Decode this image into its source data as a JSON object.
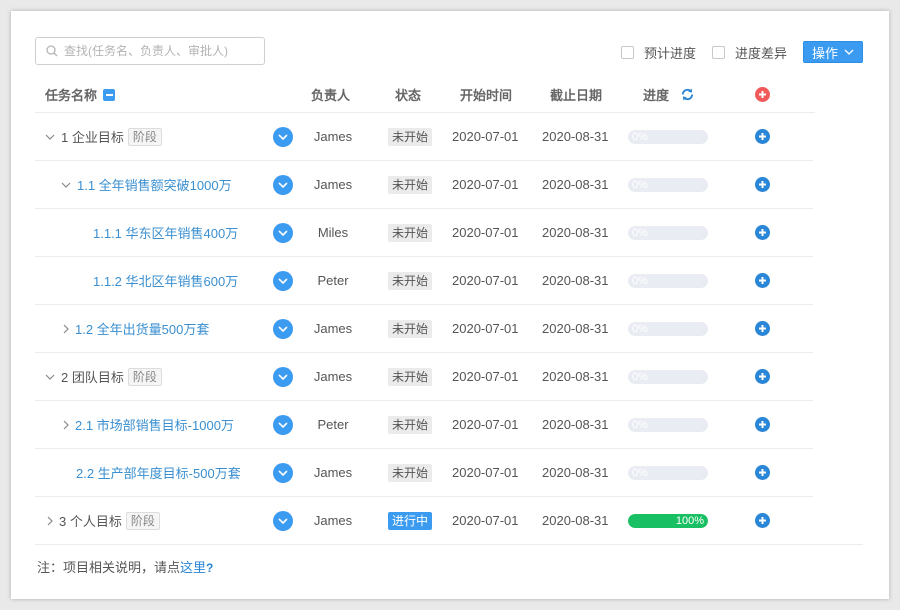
{
  "search": {
    "placeholder": "查找(任务名、负责人、审批人)"
  },
  "toolbar": {
    "planned_progress_label": "预计进度",
    "progress_diff_label": "进度差异",
    "operations_label": "操作"
  },
  "columns": {
    "task_name": "任务名称",
    "owner": "负责人",
    "status": "状态",
    "start": "开始时间",
    "end": "截止日期",
    "progress": "进度"
  },
  "rows": [
    {
      "name": "1 企业目标",
      "tag": "阶段",
      "owner": "James",
      "status": "未开始",
      "start": "2020-07-01",
      "end": "2020-08-31",
      "progress_label": "0%",
      "progress": 0
    },
    {
      "name": "1.1 全年销售额突破1000万",
      "tag": "",
      "owner": "James",
      "status": "未开始",
      "start": "2020-07-01",
      "end": "2020-08-31",
      "progress_label": "0%",
      "progress": 0
    },
    {
      "name": "1.1.1 华东区年销售400万",
      "tag": "",
      "owner": "Miles",
      "status": "未开始",
      "start": "2020-07-01",
      "end": "2020-08-31",
      "progress_label": "0%",
      "progress": 0
    },
    {
      "name": "1.1.2 华北区年销售600万",
      "tag": "",
      "owner": "Peter",
      "status": "未开始",
      "start": "2020-07-01",
      "end": "2020-08-31",
      "progress_label": "0%",
      "progress": 0
    },
    {
      "name": "1.2 全年出货量500万套",
      "tag": "",
      "owner": "James",
      "status": "未开始",
      "start": "2020-07-01",
      "end": "2020-08-31",
      "progress_label": "0%",
      "progress": 0
    },
    {
      "name": "2 团队目标",
      "tag": "阶段",
      "owner": "James",
      "status": "未开始",
      "start": "2020-07-01",
      "end": "2020-08-31",
      "progress_label": "0%",
      "progress": 0
    },
    {
      "name": "2.1 市场部销售目标-1000万",
      "tag": "",
      "owner": "Peter",
      "status": "未开始",
      "start": "2020-07-01",
      "end": "2020-08-31",
      "progress_label": "0%",
      "progress": 0
    },
    {
      "name": "2.2 生产部年度目标-500万套",
      "tag": "",
      "owner": "James",
      "status": "未开始",
      "start": "2020-07-01",
      "end": "2020-08-31",
      "progress_label": "0%",
      "progress": 0
    },
    {
      "name": "3 个人目标",
      "tag": "阶段",
      "owner": "James",
      "status": "进行中",
      "start": "2020-07-01",
      "end": "2020-08-31",
      "progress_label": "100%",
      "progress": 100
    }
  ],
  "footer": {
    "note": "注：项目相关说明，请点",
    "link": "这里",
    "q": "?"
  },
  "colors": {
    "accent": "#3a9bf0",
    "link": "#2a86d6",
    "progress_fill": "#19c063",
    "delete": "#f05a5a"
  }
}
